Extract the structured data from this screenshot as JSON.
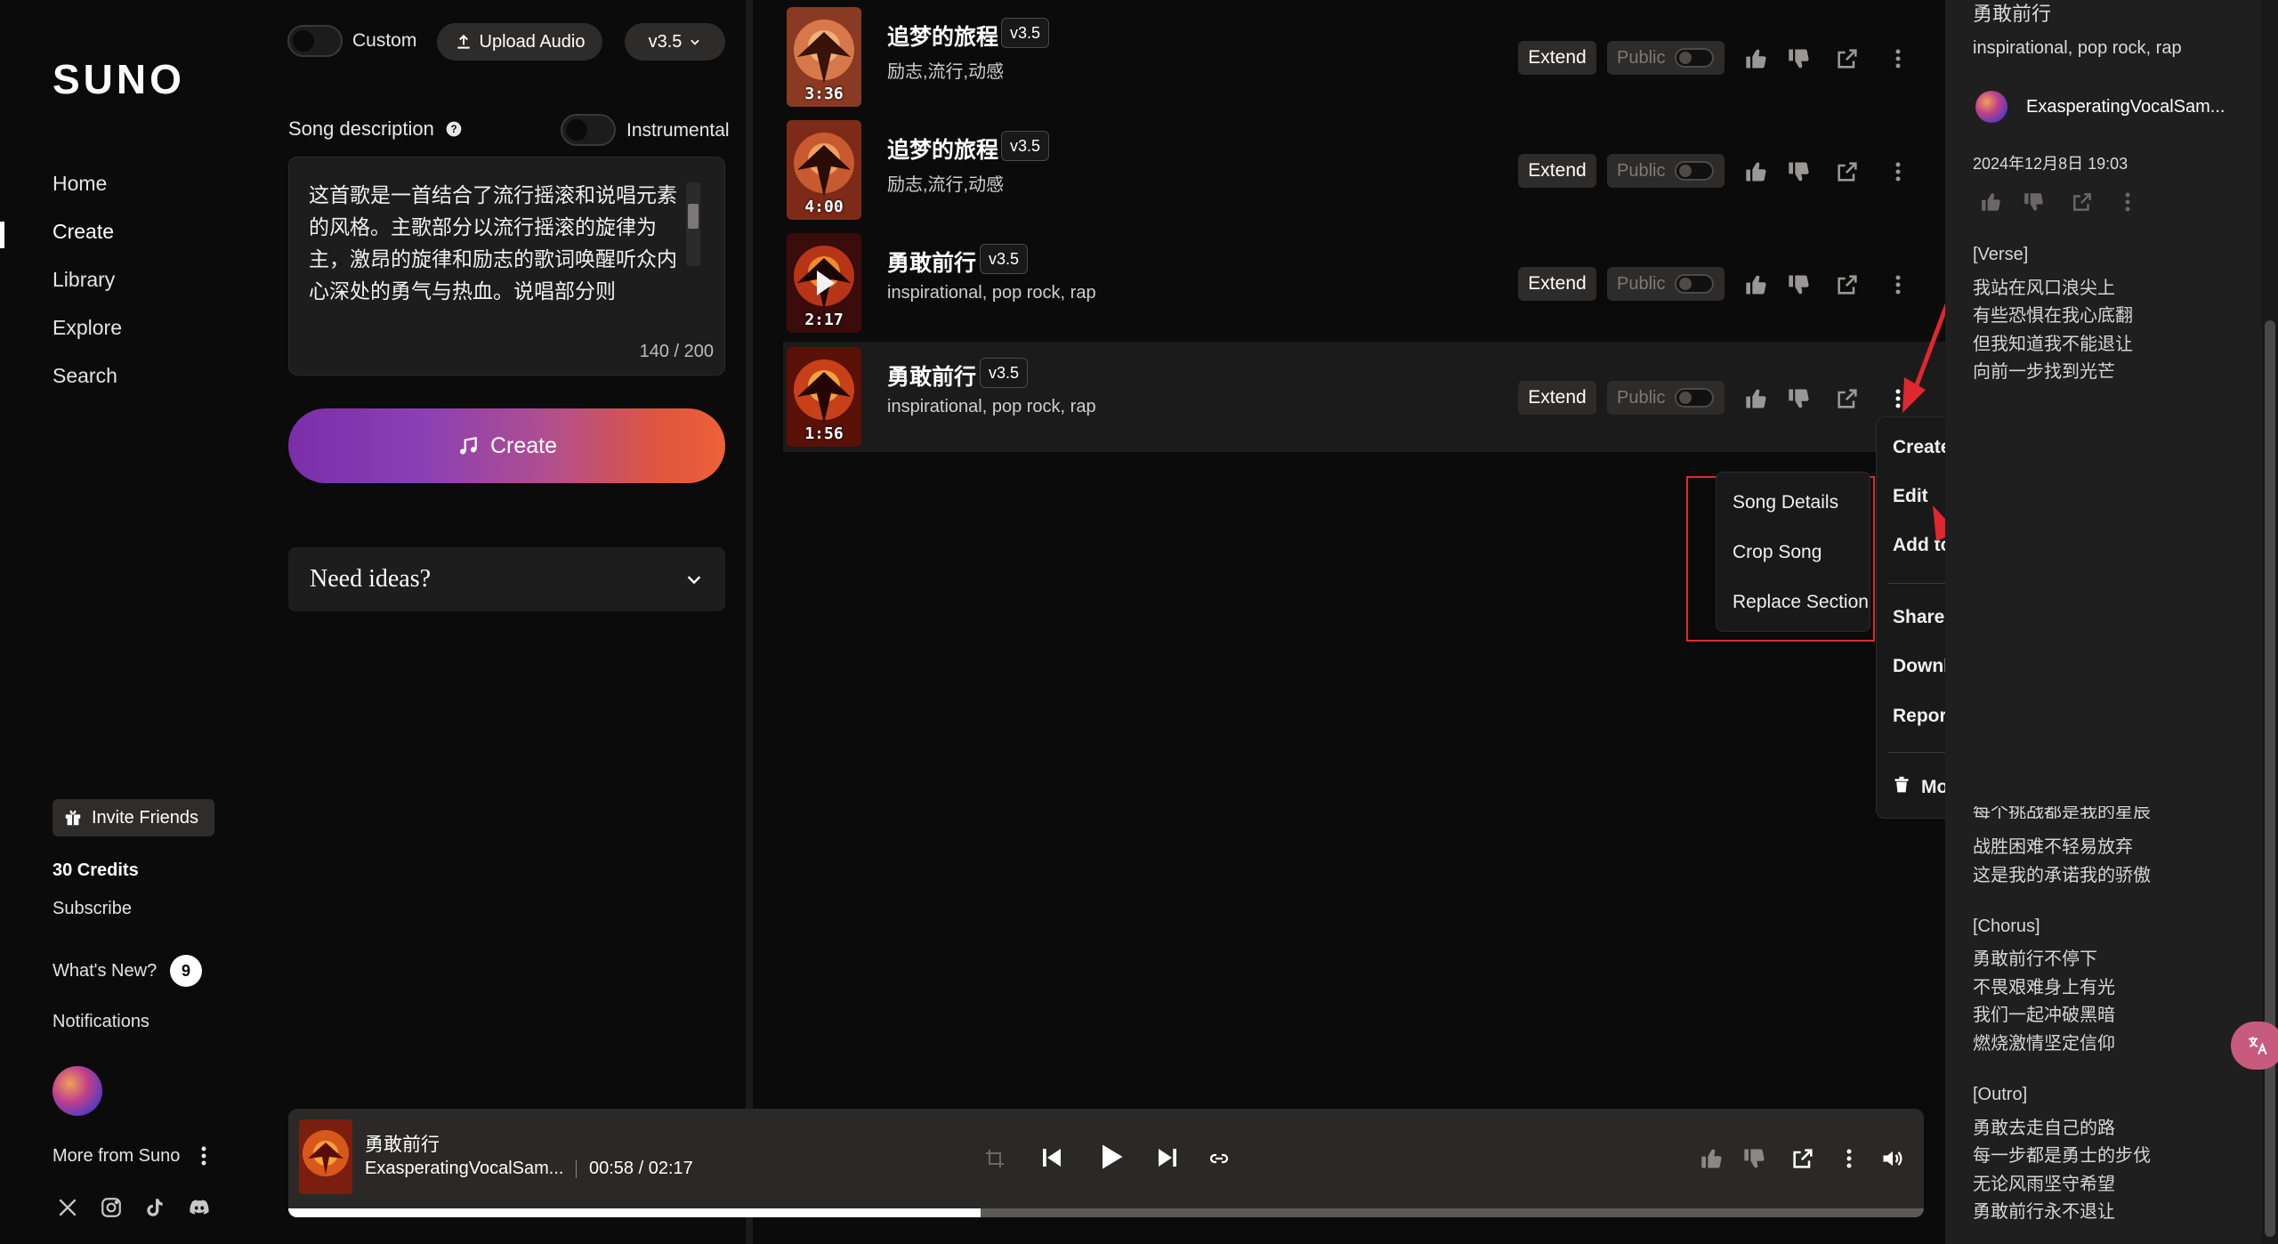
{
  "sidebar": {
    "logo": "SUNO",
    "nav": [
      "Home",
      "Create",
      "Library",
      "Explore",
      "Search"
    ],
    "invite_label": "Invite Friends",
    "credits": "30 Credits",
    "subscribe": "Subscribe",
    "whats_new": "What's New?",
    "whats_new_count": "9",
    "notifications": "Notifications",
    "more_from": "More from Suno"
  },
  "create_panel": {
    "custom_label": "Custom",
    "upload_label": "Upload Audio",
    "model": "v3.5",
    "description_label": "Song description",
    "instrumental_label": "Instrumental",
    "description_text": "这首歌是一首结合了流行摇滚和说唱元素的风格。主歌部分以流行摇滚的旋律为主，激昂的旋律和励志的歌词唤醒听众内心深处的勇气与热血。说唱部分则",
    "char_count": "140 / 200",
    "create_label": "Create",
    "ideas_label": "Need ideas?"
  },
  "songs": [
    {
      "title": "追梦的旅程",
      "version": "v3.5",
      "tags": "励志,流行,动感",
      "duration": "3:36",
      "extend": "Extend",
      "public": "Public"
    },
    {
      "title": "追梦的旅程",
      "version": "v3.5",
      "tags": "励志,流行,动感",
      "duration": "4:00",
      "extend": "Extend",
      "public": "Public"
    },
    {
      "title": "勇敢前行",
      "version": "v3.5",
      "tags": "inspirational, pop rock, rap",
      "duration": "2:17",
      "extend": "Extend",
      "public": "Public"
    },
    {
      "title": "勇敢前行",
      "version": "v3.5",
      "tags": "inspirational, pop rock, rap",
      "duration": "1:56",
      "extend": "Extend",
      "public": "Public"
    }
  ],
  "edit_submenu": [
    "Song Details",
    "Crop Song",
    "Replace Section"
  ],
  "context_menu": {
    "create": "Create",
    "edit": "Edit",
    "add_to_playlist": "Add to Playlist",
    "share": "Share",
    "download": "Download",
    "report": "Report",
    "trash": "Move to Trash"
  },
  "details": {
    "title": "勇敢前行",
    "tags": "inspirational, pop rock, rap",
    "artist": "ExasperatingVocalSam...",
    "date": "2024年12月8日 19:03",
    "lyrics_top": [
      "[Verse]",
      "我站在风口浪尖上",
      "有些恐惧在我心底翻",
      "但我知道我不能退让",
      "向前一步找到光芒"
    ],
    "lyrics_partial": "每个挑战都是我的星辰",
    "lyrics_mid": [
      "战胜困难不轻易放弃",
      "这是我的承诺我的骄傲"
    ],
    "lyrics_chorus": [
      "[Chorus]",
      "勇敢前行不停下",
      "不畏艰难身上有光",
      "我们一起冲破黑暗",
      "燃烧激情坚定信仰"
    ],
    "lyrics_outro": [
      "[Outro]",
      "勇敢去走自己的路",
      "每一步都是勇士的步伐",
      "无论风雨坚守希望",
      "勇敢前行永不退让"
    ]
  },
  "player": {
    "title": "勇敢前行",
    "artist": "ExasperatingVocalSam...",
    "time": "00:58 / 02:17",
    "progress": 0.4234
  },
  "colors": {
    "accent_gradient_start": "#7a2ea8",
    "accent_gradient_end": "#ee6137",
    "annotation_red": "#e0272f"
  }
}
